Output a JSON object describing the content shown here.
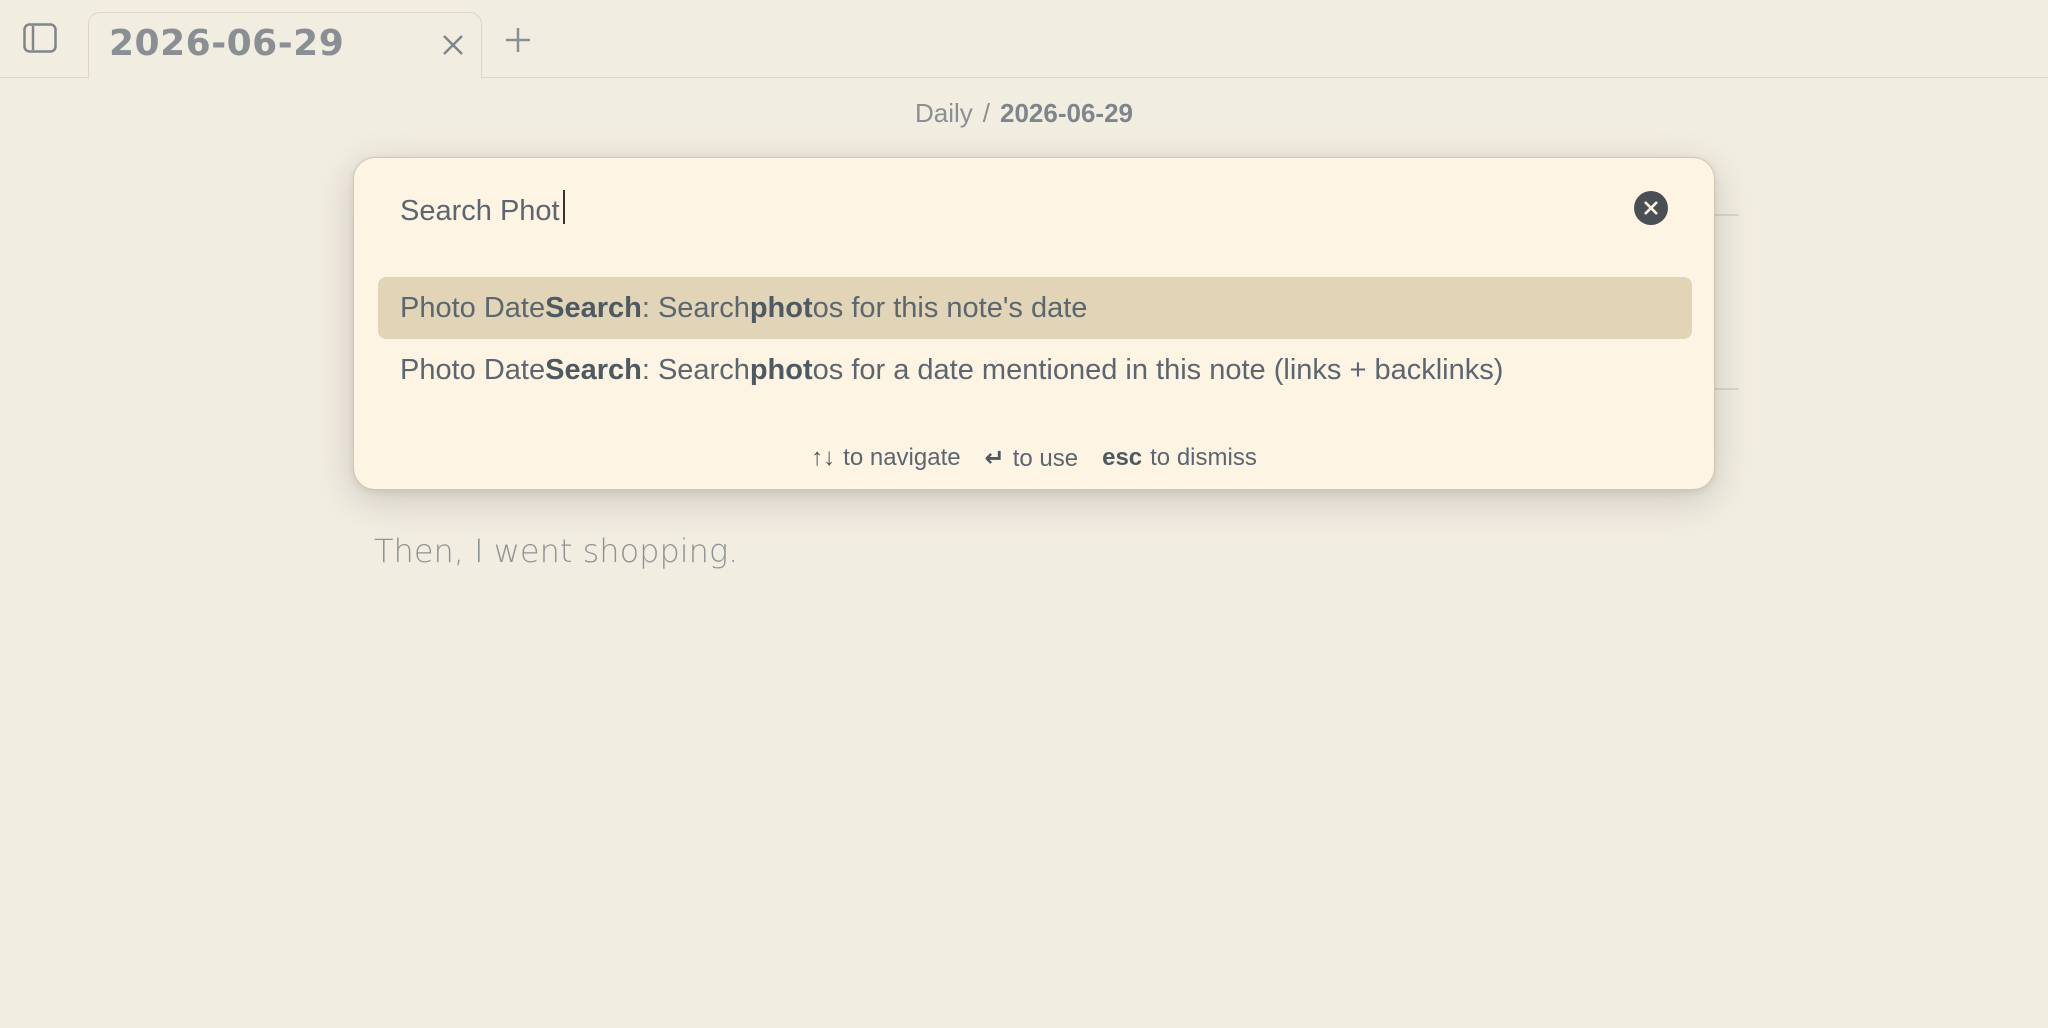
{
  "tab": {
    "title": "2026-06-29"
  },
  "breadcrumb": {
    "folder": "Daily",
    "separator": "/",
    "current": "2026-06-29"
  },
  "note": {
    "line": "Then, I went shopping."
  },
  "palette": {
    "query": "Search Phot",
    "results": [
      {
        "prefix": "Photo Date ",
        "match1": "Search",
        "mid": ": Search ",
        "match2": "phot",
        "suffix": "os for this note's date"
      },
      {
        "prefix": "Photo Date ",
        "match1": "Search",
        "mid": ": Search ",
        "match2": "phot",
        "suffix": "os for a date mentioned in this note (links + backlinks)"
      }
    ],
    "hints": [
      {
        "key": "↑↓",
        "text": "to navigate"
      },
      {
        "key": "↵",
        "text": "to use"
      },
      {
        "key": "esc",
        "text": "to dismiss"
      }
    ]
  }
}
